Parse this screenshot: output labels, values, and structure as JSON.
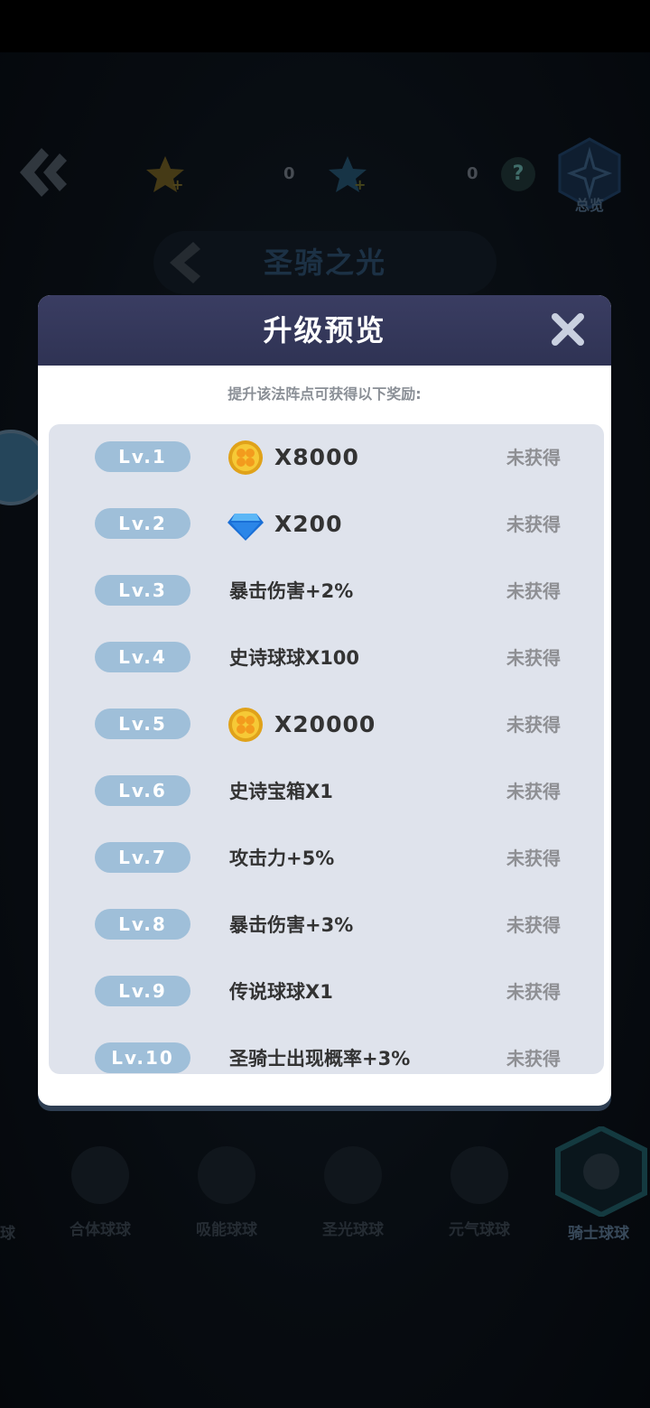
{
  "top": {
    "gold_star_count": "0",
    "blue_star_count": "0",
    "help_label": "?",
    "overview_label": "总览",
    "title": "圣骑之光"
  },
  "tabs": [
    {
      "label": "合体球球"
    },
    {
      "label": "吸能球球"
    },
    {
      "label": "圣光球球"
    },
    {
      "label": "元气球球"
    }
  ],
  "active_tab": {
    "label": "骑士球球"
  },
  "edge_tab": {
    "label": "球"
  },
  "modal": {
    "title": "升级预览",
    "subtitle": "提升该法阵点可获得以下奖励:",
    "rows": [
      {
        "level": "Lv.1",
        "reward": "X8000",
        "icon": "gold-coin-icon",
        "status": "未获得"
      },
      {
        "level": "Lv.2",
        "reward": "X200",
        "icon": "blue-diamond-icon",
        "status": "未获得"
      },
      {
        "level": "Lv.3",
        "reward": "暴击伤害+2%",
        "status": "未获得"
      },
      {
        "level": "Lv.4",
        "reward": "史诗球球X100",
        "status": "未获得"
      },
      {
        "level": "Lv.5",
        "reward": "X20000",
        "icon": "gold-coin-icon",
        "status": "未获得"
      },
      {
        "level": "Lv.6",
        "reward": "史诗宝箱X1",
        "status": "未获得"
      },
      {
        "level": "Lv.7",
        "reward": "攻击力+5%",
        "status": "未获得"
      },
      {
        "level": "Lv.8",
        "reward": "暴击伤害+3%",
        "status": "未获得"
      },
      {
        "level": "Lv.9",
        "reward": "传说球球X1",
        "status": "未获得"
      },
      {
        "level": "Lv.10",
        "reward": "圣骑士出现概率+3%",
        "status": "未获得"
      }
    ]
  },
  "colors": {
    "level_badge": "#9fbfd9",
    "header": "#34385a",
    "list_bg": "#dfe3ec"
  }
}
